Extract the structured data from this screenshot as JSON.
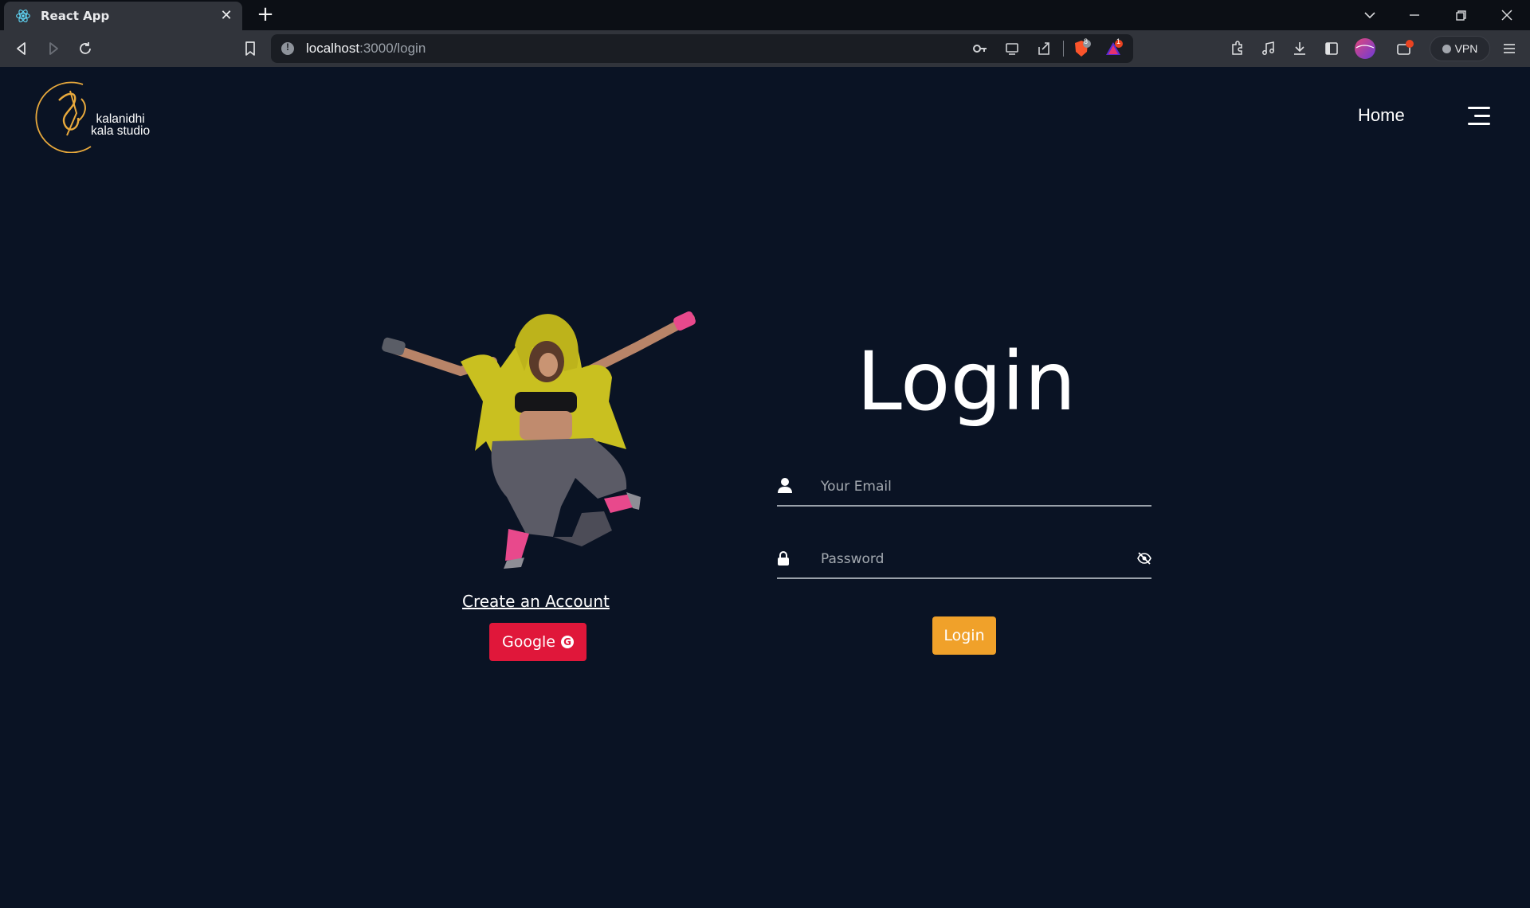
{
  "browser": {
    "tab_title": "React App",
    "new_tab_symbol": "+",
    "url_host": "localhost",
    "url_path": ":3000/login",
    "brave_badge": "8",
    "rewards_badge": "1",
    "vpn_label": "VPN"
  },
  "brand": {
    "line1": "kalanidhi",
    "line2": "kala studio"
  },
  "nav": {
    "home_label": "Home"
  },
  "left_panel": {
    "create_account_label": "Create an Account",
    "google_label": "Google",
    "google_icon_glyph": "G"
  },
  "login_form": {
    "title": "Login",
    "email_placeholder": "Your Email",
    "email_value": "",
    "password_placeholder": "Password",
    "password_value": "",
    "submit_label": "Login"
  },
  "colors": {
    "page_bg": "#0a1324",
    "google_red": "#e0173a",
    "login_orange": "#f0a12a",
    "logo_gold": "#e8a93c",
    "hoodie_yellow": "#c9c020"
  },
  "icons": {
    "tab_favicon": "react-logo-icon",
    "back": "back-arrow-icon",
    "forward": "forward-arrow-icon",
    "reload": "reload-icon",
    "bookmark": "bookmark-icon",
    "email_field": "user-icon",
    "password_field": "lock-icon",
    "password_toggle": "eye-slash-icon",
    "menu": "hamburger-menu-icon"
  }
}
